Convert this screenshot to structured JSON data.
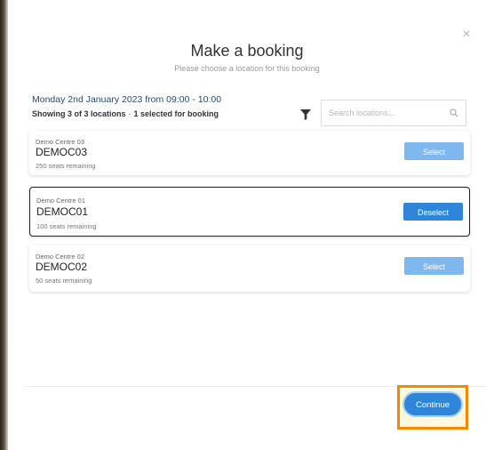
{
  "dialog": {
    "close_icon": "close-icon",
    "close_glyph": "×",
    "title": "Make a booking",
    "subtitle": "Please choose a location for this booking"
  },
  "booking": {
    "date_time": "Monday 2nd January 2023 from 09:00 - 10:00",
    "showing": "Showing 3 of 3 locations",
    "separator": "·",
    "selected_count": "1 selected for booking"
  },
  "toolbar": {
    "filter_icon": "filter-icon"
  },
  "search": {
    "placeholder": "Search locations...",
    "value": "",
    "icon": "search-icon"
  },
  "locations": [
    {
      "centre_name": "Demo Centre 03",
      "code": "DEMOC03",
      "seats": "250 seats remaining",
      "button_label": "Select",
      "selected": false
    },
    {
      "centre_name": "Demo Centre 01",
      "code": "DEMOC01",
      "seats": "100 seats remaining",
      "button_label": "Deselect",
      "selected": true
    },
    {
      "centre_name": "Demo Centre 02",
      "code": "DEMOC02",
      "seats": "50 seats remaining",
      "button_label": "Select",
      "selected": false
    }
  ],
  "footer": {
    "continue_label": "Continue"
  },
  "colors": {
    "primary": "#2f86d8",
    "primary_light": "#7fb8ef",
    "highlight": "#f08a00",
    "date_text": "#2b4a66"
  }
}
